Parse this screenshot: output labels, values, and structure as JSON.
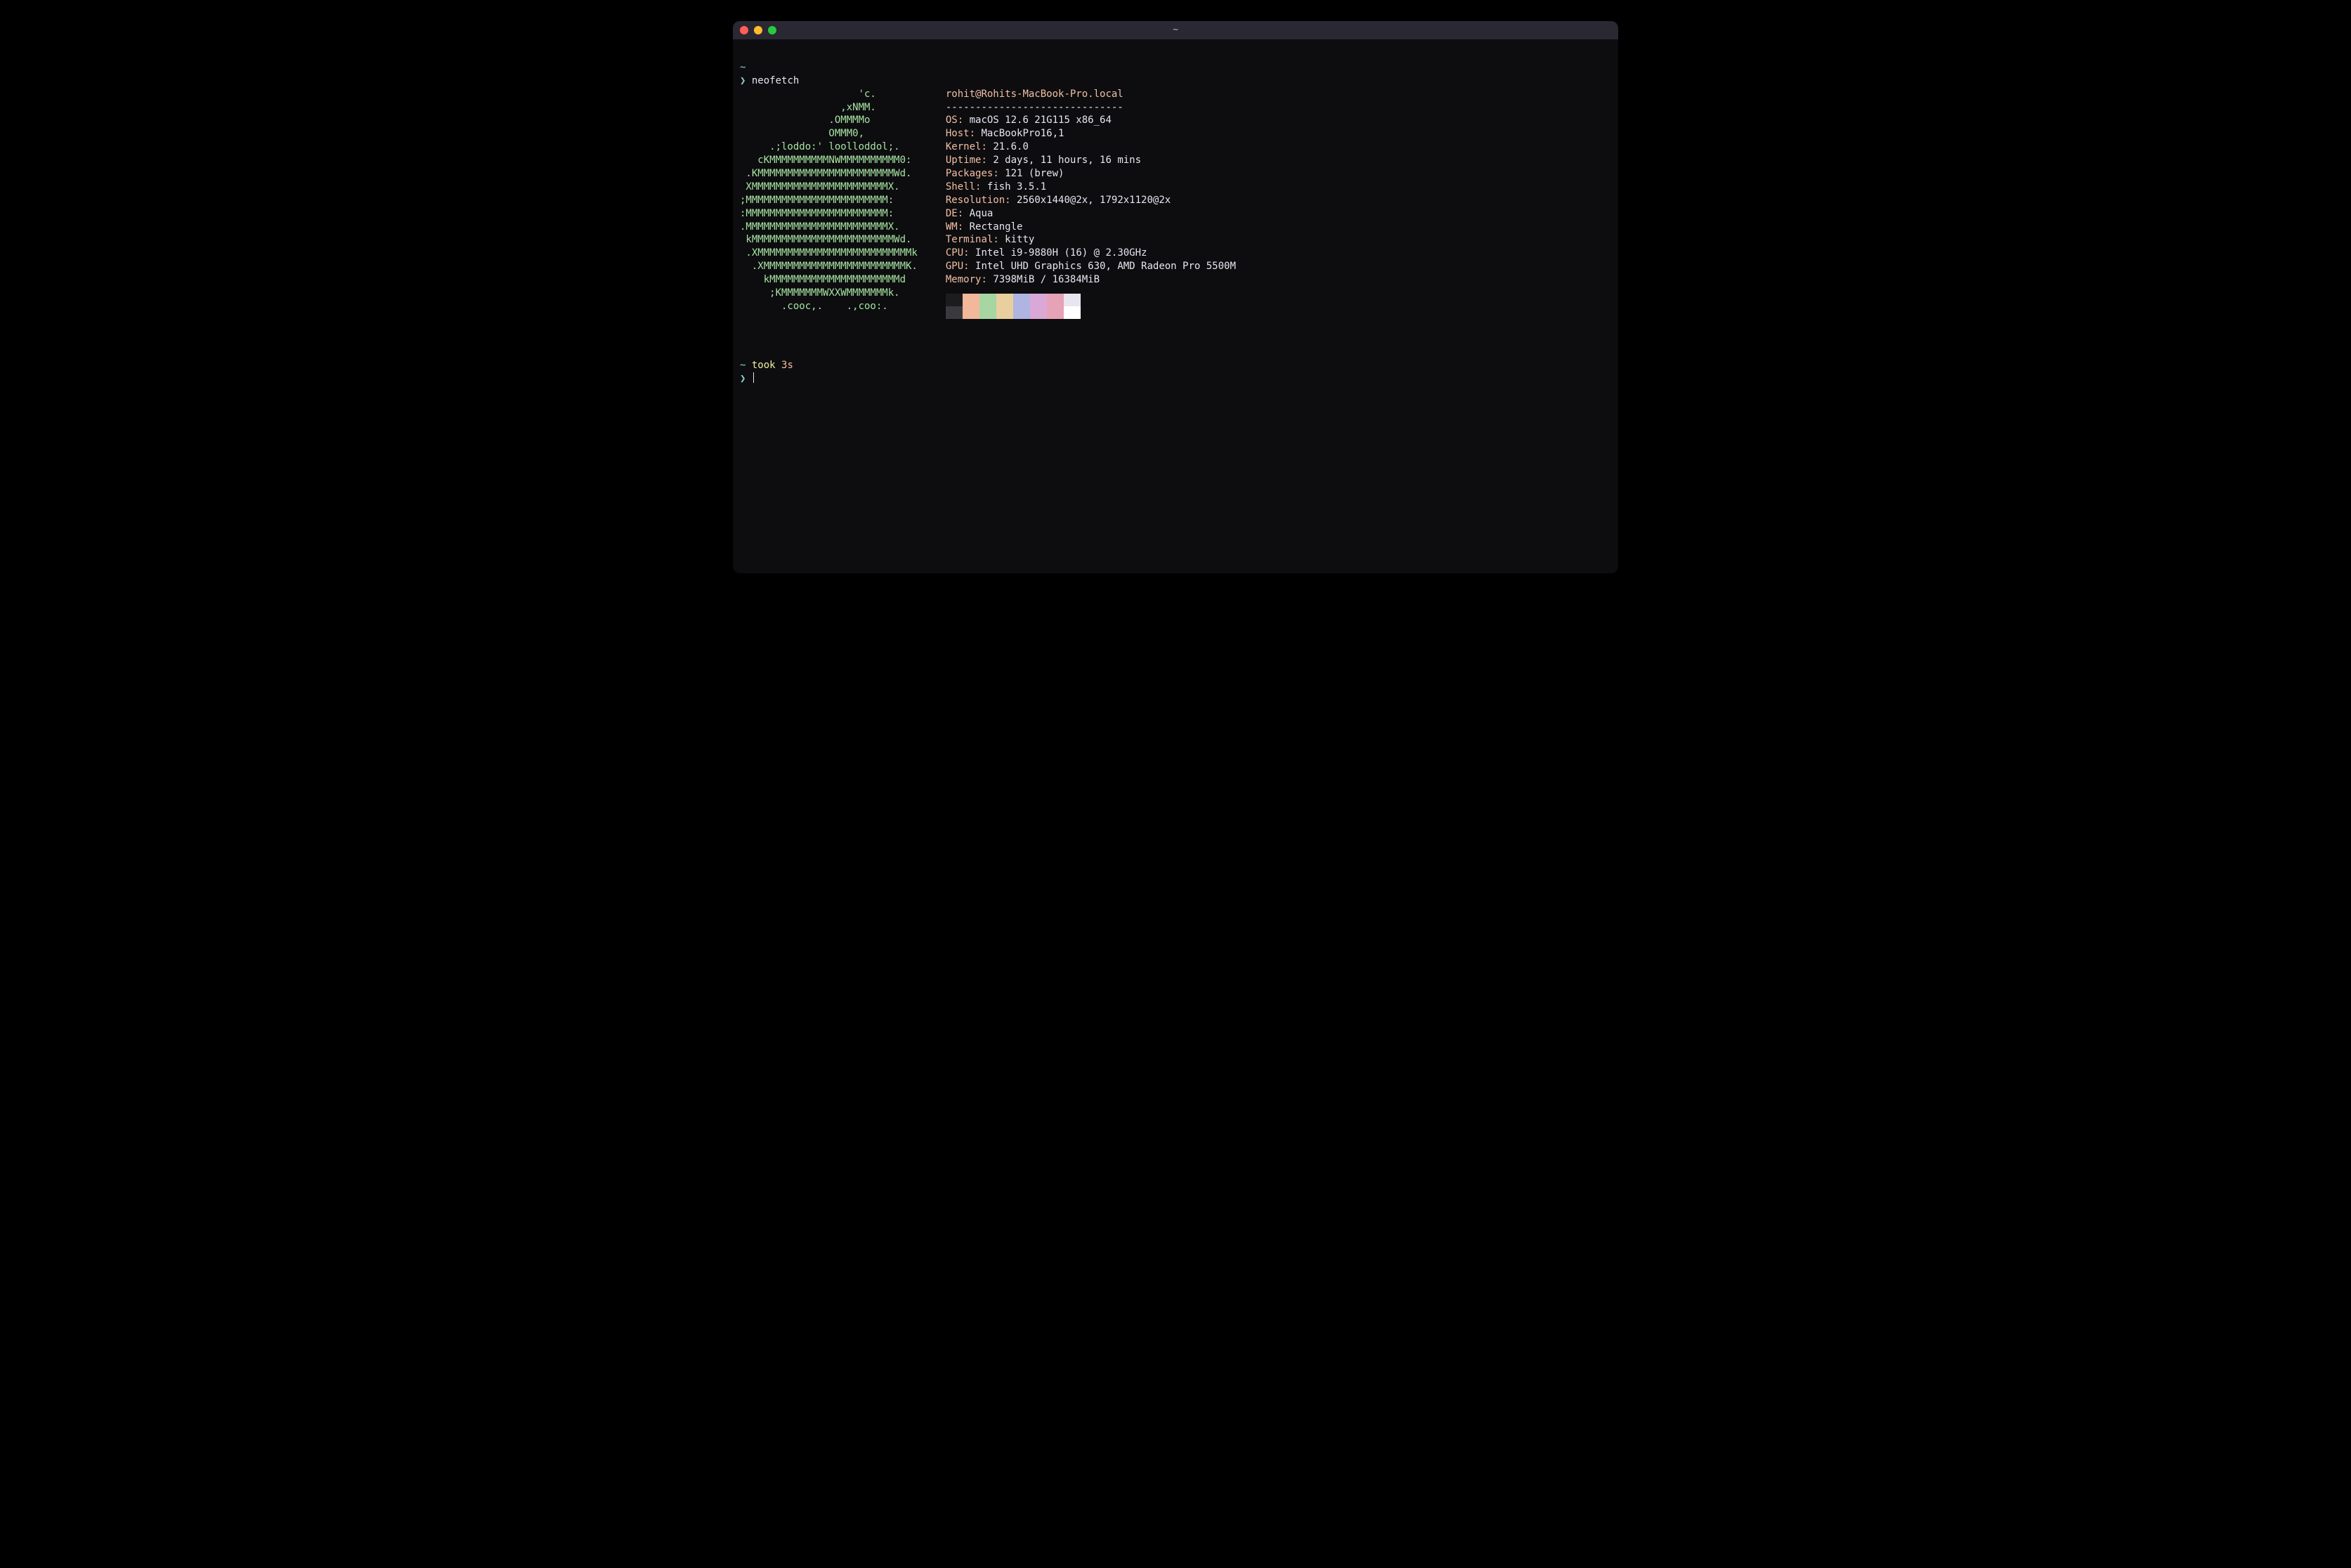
{
  "window": {
    "title": "~"
  },
  "prompt1": {
    "cwd": "~",
    "symbol": "❯",
    "command": "neofetch"
  },
  "logo_lines": [
    "                    'c.",
    "                 ,xNMM.",
    "               .OMMMMo",
    "               OMMM0,",
    "     .;loddo:' loolloddol;.",
    "   cKMMMMMMMMMMNWMMMMMMMMMM0:",
    " .KMMMMMMMMMMMMMMMMMMMMMMMWd.",
    " XMMMMMMMMMMMMMMMMMMMMMMMX.",
    ";MMMMMMMMMMMMMMMMMMMMMMMM:",
    ":MMMMMMMMMMMMMMMMMMMMMMMM:",
    ".MMMMMMMMMMMMMMMMMMMMMMMMX.",
    " kMMMMMMMMMMMMMMMMMMMMMMMMWd.",
    " .XMMMMMMMMMMMMMMMMMMMMMMMMMMk",
    "  .XMMMMMMMMMMMMMMMMMMMMMMMMK.",
    "    kMMMMMMMMMMMMMMMMMMMMMMd",
    "     ;KMMMMMMMWXXWMMMMMMMk.",
    "       .cooc,.    .,coo:."
  ],
  "userhost": "rohit@Rohits-MacBook-Pro.local",
  "separator": "------------------------------",
  "fields": [
    {
      "key": "OS",
      "value": "macOS 12.6 21G115 x86_64"
    },
    {
      "key": "Host",
      "value": "MacBookPro16,1"
    },
    {
      "key": "Kernel",
      "value": "21.6.0"
    },
    {
      "key": "Uptime",
      "value": "2 days, 11 hours, 16 mins"
    },
    {
      "key": "Packages",
      "value": "121 (brew)"
    },
    {
      "key": "Shell",
      "value": "fish 3.5.1"
    },
    {
      "key": "Resolution",
      "value": "2560x1440@2x, 1792x1120@2x"
    },
    {
      "key": "DE",
      "value": "Aqua"
    },
    {
      "key": "WM",
      "value": "Rectangle"
    },
    {
      "key": "Terminal",
      "value": "kitty"
    },
    {
      "key": "CPU",
      "value": "Intel i9-9880H (16) @ 2.30GHz"
    },
    {
      "key": "GPU",
      "value": "Intel UHD Graphics 630, AMD Radeon Pro 5500M"
    },
    {
      "key": "Memory",
      "value": "7398MiB / 16384MiB"
    }
  ],
  "palette": {
    "row1": [
      "#1c1c1f",
      "#f3b79a",
      "#a7d6a3",
      "#e9cf9d",
      "#afb4e0",
      "#daa8d6",
      "#e6a2b6",
      "#e8e5f0"
    ],
    "row2": [
      "#3a3a3e",
      "#f3b79a",
      "#a7d6a3",
      "#e9cf9d",
      "#afb4e0",
      "#daa8d6",
      "#e6a2b6",
      "#ffffff"
    ]
  },
  "status": {
    "cwd": "~",
    "took_label": "took",
    "duration": "3s"
  },
  "prompt2": {
    "symbol": "❯"
  }
}
